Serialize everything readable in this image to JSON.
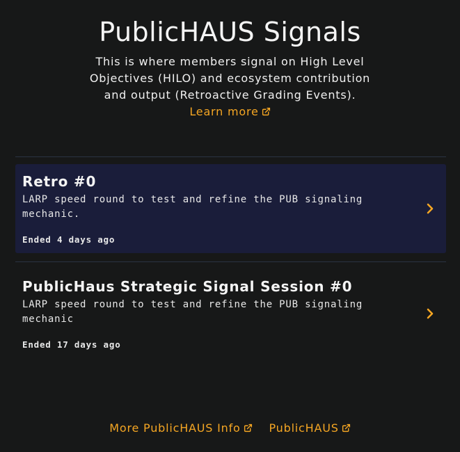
{
  "header": {
    "title": "PublicHAUS Signals",
    "description": "This is where members signal on High Level Objectives (HILO) and ecosystem contribution and output (Retroactive Grading Events).",
    "learn_more_label": "Learn more"
  },
  "signals": [
    {
      "title": "Retro #0",
      "description": "LARP speed round to test and refine the PUB signaling mechanic.",
      "status": "Ended 4 days ago"
    },
    {
      "title": "PublicHaus Strategic Signal Session #0",
      "description": "LARP speed round to test and refine the PUB signaling mechanic",
      "status": "Ended 17 days ago"
    }
  ],
  "footer": {
    "links": [
      {
        "label": "More PublicHAUS Info"
      },
      {
        "label": "PublicHAUS"
      }
    ]
  },
  "colors": {
    "background": "#171818",
    "accent": "#f5a623",
    "active_card": "#1a1d3a",
    "divider": "#2a3342"
  },
  "icons": {
    "external_link": "external-link-icon",
    "chevron": "chevron-right-icon"
  }
}
